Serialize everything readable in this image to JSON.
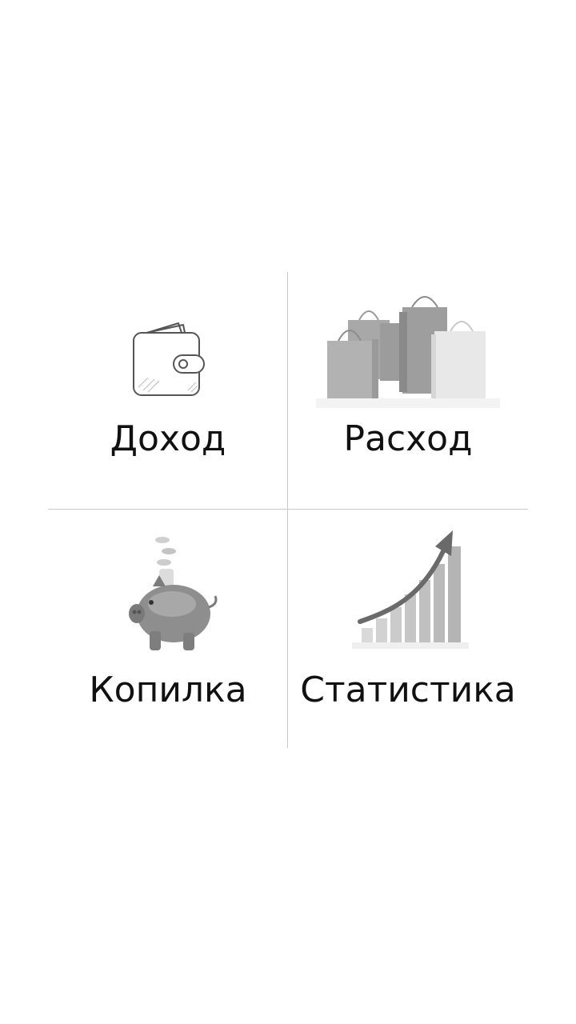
{
  "menu": {
    "items": [
      {
        "label": "Доход",
        "icon": "wallet-icon"
      },
      {
        "label": "Расход",
        "icon": "shopping-bags-icon"
      },
      {
        "label": "Копилка",
        "icon": "piggy-bank-icon"
      },
      {
        "label": "Статистика",
        "icon": "growth-chart-icon"
      }
    ]
  },
  "colors": {
    "background": "#ffffff",
    "divider": "#c8c8c8",
    "text": "#111111"
  }
}
